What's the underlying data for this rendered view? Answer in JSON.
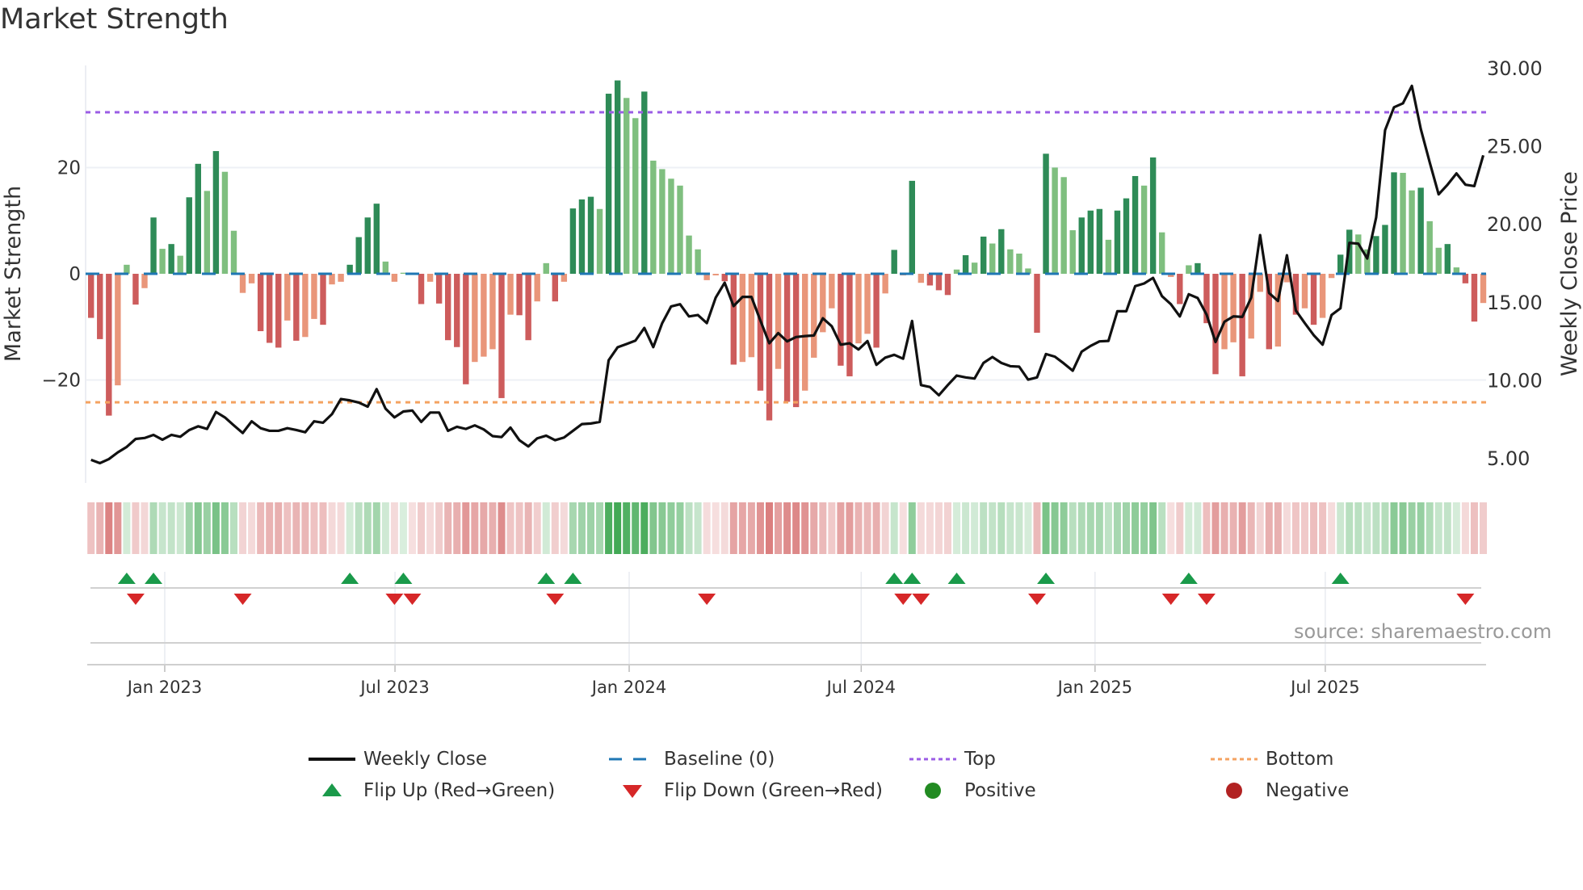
{
  "chart_data": {
    "type": "bar",
    "title": "Market Strength",
    "ylabel": "Market Strength",
    "ylabel_right": "Weekly Close Price",
    "ylim": [
      -39.3,
      39.3
    ],
    "ylim_right": [
      3.4,
      30.15
    ],
    "yticks": [
      {
        "value": 20,
        "label": "20"
      },
      {
        "value": 0,
        "label": "0"
      },
      {
        "value": -20,
        "label": "−20"
      }
    ],
    "yticks_right": [
      {
        "value": 30,
        "label": "30.00"
      },
      {
        "value": 25,
        "label": "25.00"
      },
      {
        "value": 20,
        "label": "20.00"
      },
      {
        "value": 15,
        "label": "15.00"
      },
      {
        "value": 10,
        "label": "10.00"
      },
      {
        "value": 5,
        "label": "5.00"
      }
    ],
    "xticks": [
      {
        "x_index": 8.26,
        "label": "Jan 2023"
      },
      {
        "x_index": 34.06,
        "label": "Jul 2023"
      },
      {
        "x_index": 60.3,
        "label": "Jan 2024"
      },
      {
        "x_index": 86.3,
        "label": "Jul 2024"
      },
      {
        "x_index": 112.5,
        "label": "Jan 2025"
      },
      {
        "x_index": 138.3,
        "label": "Jul 2025"
      }
    ],
    "top_level": 30.4,
    "bottom_level": -24.2,
    "baseline": 0,
    "grid": true,
    "series": [
      {
        "name": "Market Strength",
        "type": "bar",
        "values": [
          -8.3,
          -12.3,
          -26.7,
          -21,
          1.7,
          -5.8,
          -2.7,
          10.6,
          4.7,
          5.6,
          3.4,
          14.4,
          20.7,
          15.6,
          23.1,
          19.2,
          8.1,
          -3.6,
          -1.8,
          -10.8,
          -13,
          -13.9,
          -8.8,
          -12.6,
          -11.9,
          -8.5,
          -9.6,
          -2,
          -1.5,
          1.7,
          6.9,
          10.6,
          13.2,
          2.3,
          -1.5,
          0.2,
          -0.2,
          -5.7,
          -1.5,
          -5.6,
          -12.5,
          -13.8,
          -20.8,
          -16.6,
          -15.6,
          -14.2,
          -23.4,
          -7.7,
          -7.8,
          -12.5,
          -5.2,
          2,
          -5.2,
          -1.5,
          12.3,
          14,
          14.5,
          12.2,
          33.9,
          36.4,
          33.1,
          29.3,
          34.3,
          21.3,
          19.7,
          17.9,
          16.6,
          7.2,
          4.6,
          -1.2,
          -0.3,
          -1.4,
          -17.1,
          -16.6,
          -15.7,
          -22,
          -27.6,
          -17.9,
          -24.1,
          -25.1,
          -22,
          -15.8,
          -11,
          -6.5,
          -17.3,
          -19.3,
          -13.1,
          -11.3,
          -13.9,
          -3.7,
          4.5,
          -0.3,
          17.5,
          -1.7,
          -2.2,
          -3.1,
          -4,
          0.8,
          3.5,
          2.1,
          7,
          5.7,
          8.4,
          4.6,
          3.8,
          1,
          -11.1,
          22.6,
          20,
          18.2,
          8.2,
          10.6,
          11.9,
          12.2,
          6.4,
          11.9,
          14.2,
          18.4,
          16.6,
          21.9,
          7.8,
          -0.6,
          -5.7,
          1.6,
          2,
          -9.3,
          -18.9,
          -14.2,
          -12.9,
          -19.3,
          -12.2,
          -3.4,
          -14.2,
          -13.7,
          -1.6,
          -7.7,
          -6.5,
          -9.6,
          -8.3,
          -0.8,
          3.6,
          8.3,
          7.4,
          4.6,
          7.1,
          9.2,
          19.1,
          19,
          15.7,
          16.2,
          9.9,
          4.9,
          5.6,
          1.2,
          -1.8,
          -9,
          -5.5
        ]
      },
      {
        "name": "Weekly Close",
        "type": "line",
        "axis": "right",
        "values": [
          4.88,
          4.67,
          4.93,
          5.36,
          5.71,
          6.22,
          6.28,
          6.48,
          6.17,
          6.48,
          6.36,
          6.79,
          7.03,
          6.86,
          7.95,
          7.6,
          7.09,
          6.6,
          7.35,
          6.91,
          6.74,
          6.74,
          6.91,
          6.79,
          6.65,
          7.35,
          7.26,
          7.81,
          8.78,
          8.69,
          8.55,
          8.29,
          9.41,
          8.16,
          7.6,
          7.98,
          8.04,
          7.31,
          7.91,
          7.91,
          6.74,
          7.0,
          6.86,
          7.09,
          6.83,
          6.4,
          6.34,
          6.95,
          6.14,
          5.74,
          6.26,
          6.43,
          6.14,
          6.31,
          6.74,
          7.17,
          7.21,
          7.31,
          11.26,
          12.09,
          12.3,
          12.52,
          13.33,
          12.1,
          13.64,
          14.71,
          14.85,
          14.07,
          14.16,
          13.64,
          15.28,
          16.23,
          14.73,
          15.32,
          15.32,
          13.81,
          12.35,
          13.0,
          12.47,
          12.75,
          12.81,
          12.85,
          13.95,
          13.44,
          12.26,
          12.35,
          11.95,
          12.49,
          10.97,
          11.43,
          11.61,
          11.36,
          13.78,
          9.67,
          9.55,
          9.02,
          9.67,
          10.28,
          10.16,
          10.09,
          11.09,
          11.47,
          11.09,
          10.88,
          10.85,
          10.02,
          10.16,
          11.66,
          11.49,
          11.06,
          10.59,
          11.81,
          12.18,
          12.47,
          12.5,
          14.4,
          14.4,
          16.01,
          16.18,
          16.54,
          15.37,
          14.85,
          14.07,
          15.49,
          15.25,
          14.19,
          12.43,
          13.73,
          14.07,
          14.04,
          15.28,
          19.28,
          15.57,
          15.06,
          17.99,
          14.45,
          13.64,
          12.87,
          12.26,
          14.16,
          14.59,
          18.78,
          18.73,
          17.78,
          20.41,
          26.0,
          27.47,
          27.72,
          28.84,
          26.08,
          23.94,
          21.89,
          22.51,
          23.23,
          22.51,
          22.42,
          24.39
        ]
      }
    ],
    "legend": {
      "placement": "bottom",
      "items": [
        {
          "label": "Weekly Close",
          "symbol": "line"
        },
        {
          "label": "Baseline (0)",
          "symbol": "dash"
        },
        {
          "label": "Top",
          "symbol": "dot-purple"
        },
        {
          "label": "Bottom",
          "symbol": "dot-orange"
        },
        {
          "label": "Flip Up (Red→Green)",
          "symbol": "triangle-up"
        },
        {
          "label": "Flip Down (Green→Red)",
          "symbol": "triangle-down"
        },
        {
          "label": "Positive",
          "symbol": "circle-green"
        },
        {
          "label": "Negative",
          "symbol": "circle-red"
        }
      ]
    },
    "source": "source: sharemaestro.com"
  },
  "colors": {
    "pos_strong": "#2e8b57",
    "pos_weak": "#7fbf7f",
    "neg_strong": "#cd5c5c",
    "neg_weak": "#e9967a",
    "baseline": "#1f77b4",
    "top": "#9b5de5",
    "bottom": "#f4a261",
    "line": "#111111",
    "flip_up": "#1a9a4a",
    "flip_down": "#d62728",
    "positive": "#228b22",
    "negative": "#b22222"
  }
}
